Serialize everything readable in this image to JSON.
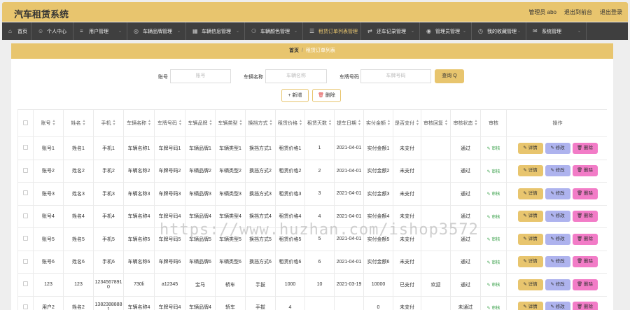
{
  "app": {
    "title": "汽车租赁系统"
  },
  "header_links": {
    "user": "管理员 abo",
    "front": "退出到前台",
    "logout": "退出登录"
  },
  "nav": [
    {
      "label": "首页",
      "icon": "home-icon",
      "glyph": "⌂"
    },
    {
      "label": "个人中心",
      "icon": "user-icon",
      "glyph": "☺"
    },
    {
      "label": "用户管理",
      "icon": "sliders-icon",
      "glyph": "≡"
    },
    {
      "label": "车辆品牌管理",
      "icon": "globe-icon",
      "glyph": "◎"
    },
    {
      "label": "车辆信息管理",
      "icon": "grid-icon",
      "glyph": "▦"
    },
    {
      "label": "车辆颜色管理",
      "icon": "cart-icon",
      "glyph": "⚆"
    },
    {
      "label": "租赁订单列表管理",
      "icon": "list-icon",
      "glyph": "☰"
    },
    {
      "label": "还车记录管理",
      "icon": "transfer-icon",
      "glyph": "⇄"
    },
    {
      "label": "管理员管理",
      "icon": "pin-icon",
      "glyph": "◉"
    },
    {
      "label": "我的收藏管理",
      "icon": "clock-icon",
      "glyph": "◷"
    },
    {
      "label": "系统管理",
      "icon": "mail-icon",
      "glyph": "✉"
    }
  ],
  "breadcrumb": {
    "home": "首页",
    "sep": "/",
    "current": "租赁订单列表"
  },
  "search": {
    "account_label": "账号",
    "account_placeholder": "账号",
    "car_name_label": "车辆名称",
    "car_name_placeholder": "车辆名称",
    "plate_label": "车牌号码",
    "plate_placeholder": "车牌号码",
    "query_label": "查询 Q"
  },
  "actions": {
    "add": "+ 新增",
    "delete": "删除"
  },
  "table": {
    "headers": [
      "账号",
      "姓名",
      "手机",
      "车辆名称",
      "车牌号码",
      "车辆品牌",
      "车辆类型",
      "换挡方式",
      "租赁价格",
      "租赁天数",
      "提车日期",
      "实付金额",
      "是否支付",
      "审核回复",
      "审核状态",
      "审核",
      "操作"
    ],
    "audit_label": "审核",
    "op_detail": "详情",
    "op_edit": "修改",
    "op_remove": "删除",
    "rows": [
      [
        "账号1",
        "姓名1",
        "手机1",
        "车辆名称1",
        "车牌号码1",
        "车辆品牌1",
        "车辆类型1",
        "换挡方式1",
        "租赁价格1",
        "1",
        "2021-04-01",
        "实付金额1",
        "未支付",
        "",
        "通过"
      ],
      [
        "账号2",
        "姓名2",
        "手机2",
        "车辆名称2",
        "车牌号码2",
        "车辆品牌2",
        "车辆类型2",
        "换挡方式2",
        "租赁价格2",
        "2",
        "2021-04-01",
        "实付金额2",
        "未支付",
        "",
        "通过"
      ],
      [
        "账号3",
        "姓名3",
        "手机3",
        "车辆名称3",
        "车牌号码3",
        "车辆品牌3",
        "车辆类型3",
        "换挡方式3",
        "租赁价格3",
        "3",
        "2021-04-01",
        "实付金额3",
        "未支付",
        "",
        "通过"
      ],
      [
        "账号4",
        "姓名4",
        "手机4",
        "车辆名称4",
        "车牌号码4",
        "车辆品牌4",
        "车辆类型4",
        "换挡方式4",
        "租赁价格4",
        "4",
        "2021-04-01",
        "实付金额4",
        "未支付",
        "",
        "通过"
      ],
      [
        "账号5",
        "姓名5",
        "手机5",
        "车辆名称5",
        "车牌号码5",
        "车辆品牌5",
        "车辆类型5",
        "换挡方式5",
        "租赁价格5",
        "5",
        "2021-04-01",
        "实付金额5",
        "未支付",
        "",
        "通过"
      ],
      [
        "账号6",
        "姓名6",
        "手机6",
        "车辆名称6",
        "车牌号码6",
        "车辆品牌6",
        "车辆类型6",
        "换挡方式6",
        "租赁价格6",
        "6",
        "2021-04-01",
        "实付金额6",
        "未支付",
        "",
        "通过"
      ],
      [
        "123",
        "123",
        "12345678910",
        "730li",
        "a12345",
        "宝马",
        "轿车",
        "手拔",
        "1000",
        "10",
        "2021-03-19",
        "10000",
        "已支付",
        "欢迎",
        "通过"
      ],
      [
        "用户2",
        "姓名2",
        "13823888881",
        "车辆名称4",
        "车牌号码4",
        "车辆品牌4",
        "轿车",
        "手拔",
        "4",
        "",
        "",
        "0",
        "未支付",
        "",
        "未通过"
      ]
    ]
  },
  "watermark": "https://www.huzhan.com/ishop3572",
  "colors": {
    "accent": "#e8c56e",
    "nav_bg": "#3f3f3f",
    "edit": "#aeb3ee",
    "remove": "#f27cc7",
    "audit": "#3aa14a"
  }
}
